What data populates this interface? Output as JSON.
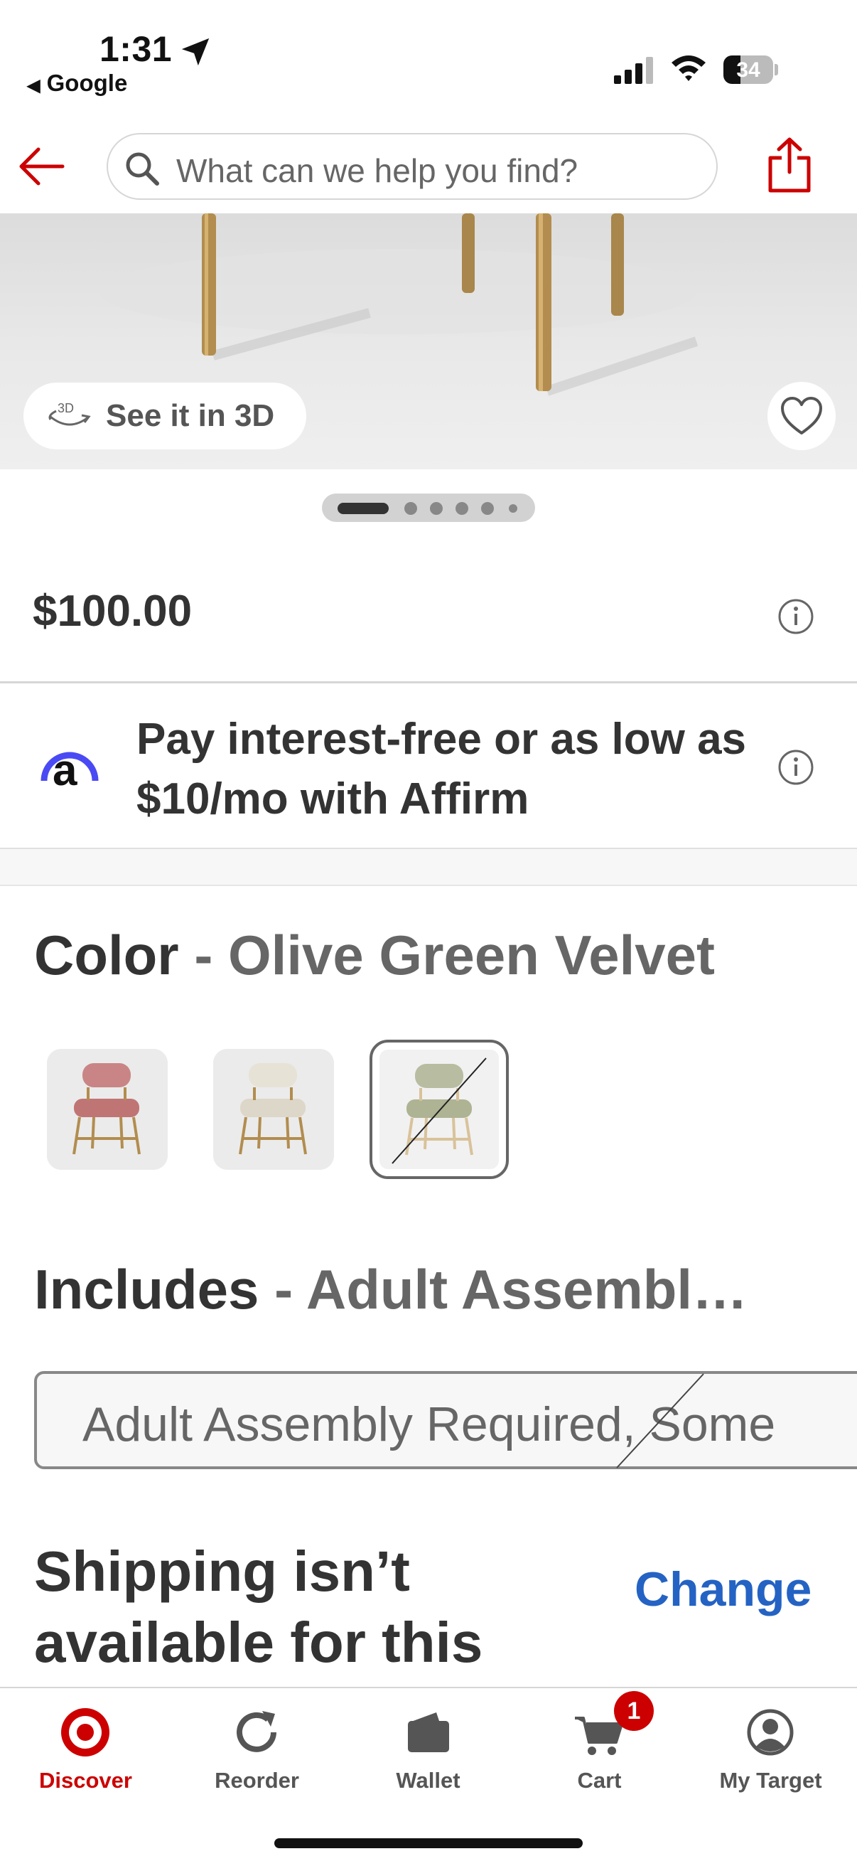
{
  "status_bar": {
    "time": "1:31",
    "back_app": "Google",
    "battery": "34"
  },
  "header": {
    "search_placeholder": "What can we help you find?"
  },
  "gallery": {
    "view_3d_label": "See it in 3D",
    "image_count": 6,
    "current_image": 1
  },
  "product": {
    "price": "$100.00",
    "affirm_text": "Pay interest-free or as low as $10/mo with Affirm",
    "affirm_logo_letter": "a"
  },
  "color": {
    "label": "Color",
    "separator": "-",
    "selected": "Olive Green Velvet",
    "swatches": [
      {
        "name": "Pink Velvet",
        "seat_color": "#c98585",
        "available": true
      },
      {
        "name": "Cream",
        "seat_color": "#e7e2d6",
        "available": true
      },
      {
        "name": "Olive Green Velvet",
        "seat_color": "#b8bda1",
        "available": false,
        "selected": true
      }
    ]
  },
  "includes": {
    "label": "Includes",
    "separator": "-",
    "selected": "Adult Assembl…",
    "option_text": "Adult Assembly Required, Some"
  },
  "shipping": {
    "text": "Shipping isn’t available for this",
    "change_label": "Change"
  },
  "tab_bar": {
    "items": [
      {
        "label": "Discover",
        "icon": "target-logo-icon",
        "active": true
      },
      {
        "label": "Reorder",
        "icon": "reorder-icon"
      },
      {
        "label": "Wallet",
        "icon": "wallet-icon"
      },
      {
        "label": "Cart",
        "icon": "cart-icon"
      },
      {
        "label": "My Target",
        "icon": "account-icon"
      }
    ],
    "cart_badge": "1"
  },
  "colors": {
    "brand_red": "#cc0000",
    "link_blue": "#2463c3",
    "affirm_blue": "#4a4af4"
  }
}
